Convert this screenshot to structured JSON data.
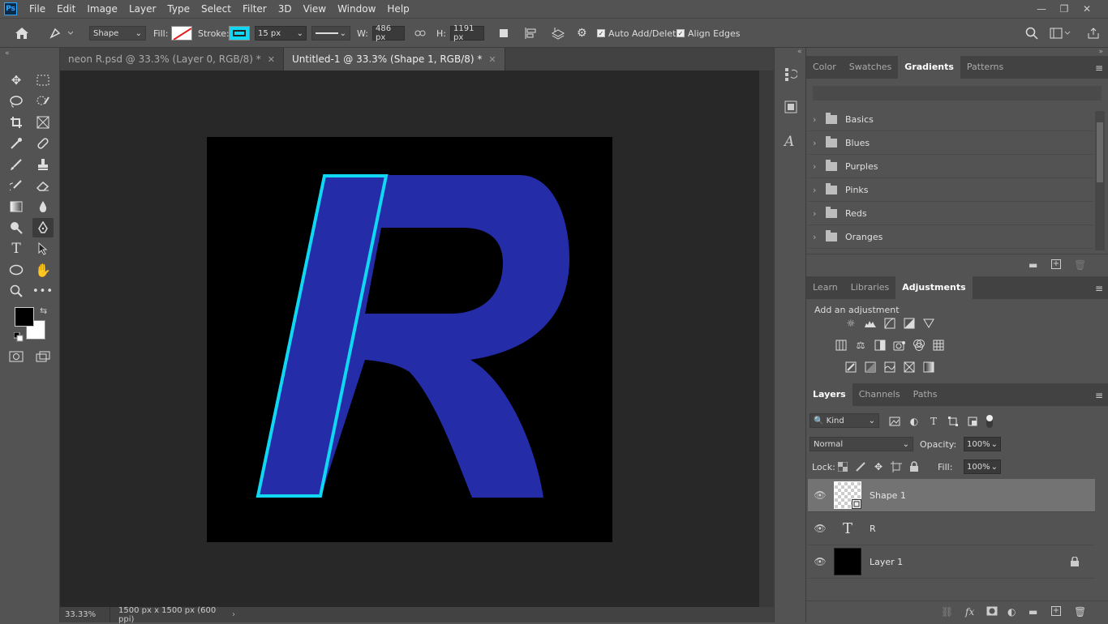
{
  "app": {
    "logo": "Ps"
  },
  "menu": [
    "File",
    "Edit",
    "Image",
    "Layer",
    "Type",
    "Select",
    "Filter",
    "3D",
    "View",
    "Window",
    "Help"
  ],
  "window_controls": {
    "minimize": "—",
    "restore": "❐",
    "close": "✕"
  },
  "options": {
    "mode": "Shape",
    "fill_label": "Fill:",
    "stroke_label": "Stroke:",
    "stroke_width": "15 px",
    "w_label": "W:",
    "w_value": "486 px",
    "h_label": "H:",
    "h_value": "1191 px",
    "auto_add_delete": "Auto Add/Delete",
    "align_edges": "Align Edges"
  },
  "tabs": [
    {
      "label": "neon R.psd @ 33.3% (Layer 0, RGB/8) *",
      "active": false
    },
    {
      "label": "Untitled-1 @ 33.3% (Shape 1, RGB/8) *",
      "active": true
    }
  ],
  "status": {
    "zoom": "33.33%",
    "doc_info": "1500 px x 1500 px (600 ppi)"
  },
  "colors": {
    "letter_fill": "#242ca8",
    "stroke": "#11d8f2",
    "canvas_bg": "#000000"
  },
  "gradients_panel": {
    "tabs": [
      "Color",
      "Swatches",
      "Gradients",
      "Patterns"
    ],
    "active_tab": "Gradients",
    "groups": [
      "Basics",
      "Blues",
      "Purples",
      "Pinks",
      "Reds",
      "Oranges"
    ]
  },
  "adjustments_panel": {
    "tabs": [
      "Learn",
      "Libraries",
      "Adjustments"
    ],
    "active_tab": "Adjustments",
    "heading": "Add an adjustment"
  },
  "layers_panel": {
    "tabs": [
      "Layers",
      "Channels",
      "Paths"
    ],
    "active_tab": "Layers",
    "kind": "Kind",
    "blend_mode": "Normal",
    "opacity_label": "Opacity:",
    "opacity": "100%",
    "lock_label": "Lock:",
    "fill_label": "Fill:",
    "fill": "100%",
    "layers": [
      {
        "name": "Shape 1",
        "type": "shape",
        "selected": true
      },
      {
        "name": "R",
        "type": "text",
        "selected": false
      },
      {
        "name": "Layer 1",
        "type": "pixel",
        "selected": false,
        "locked": true
      }
    ]
  }
}
